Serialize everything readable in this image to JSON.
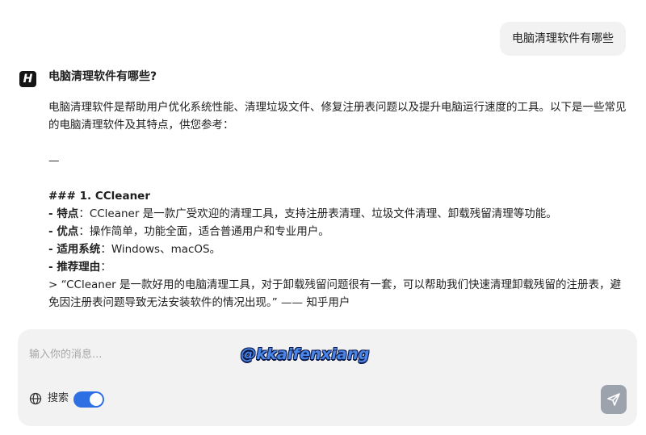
{
  "user_message": "电脑清理软件有哪些",
  "bot": {
    "avatar_letter": "H",
    "title": "电脑清理软件有哪些?",
    "intro": "电脑清理软件是帮助用户优化系统性能、清理垃圾文件、修复注册表问题以及提升电脑运行速度的工具。以下是一些常见的电脑清理软件及其特点，供您参考：",
    "divider": "—",
    "section_heading": "### 1. CCleaner",
    "items": [
      {
        "prefix": "- ",
        "label": "特点",
        "sep": "：",
        "text": "CCleaner 是一款广受欢迎的清理工具，支持注册表清理、垃圾文件清理、卸载残留清理等功能。"
      },
      {
        "prefix": "- ",
        "label": "优点",
        "sep": "：",
        "text": "操作简单，功能全面，适合普通用户和专业用户。"
      },
      {
        "prefix": "- ",
        "label": "适用系统",
        "sep": "：",
        "text": "Windows、macOS。"
      },
      {
        "prefix": "- ",
        "label": "推荐理由",
        "sep": "：",
        "text": ""
      }
    ],
    "quote": "> “CCleaner 是一款好用的电脑清理工具，对于卸载残留问题很有一套，可以帮助我们快速清理卸载残留的注册表，避免因注册表问题导致无法安装软件的情况出现。” —— 知乎用户"
  },
  "composer": {
    "placeholder": "输入你的消息...",
    "search_label": "搜索",
    "search_toggle_on": true,
    "globe_icon": "globe-icon",
    "send_icon": "send-icon"
  },
  "watermark": "@kkaifenxiang",
  "colors": {
    "toggle": "#2f6fe4",
    "send_button": "#9da3ad",
    "composer_bg": "#f2f2f2"
  }
}
